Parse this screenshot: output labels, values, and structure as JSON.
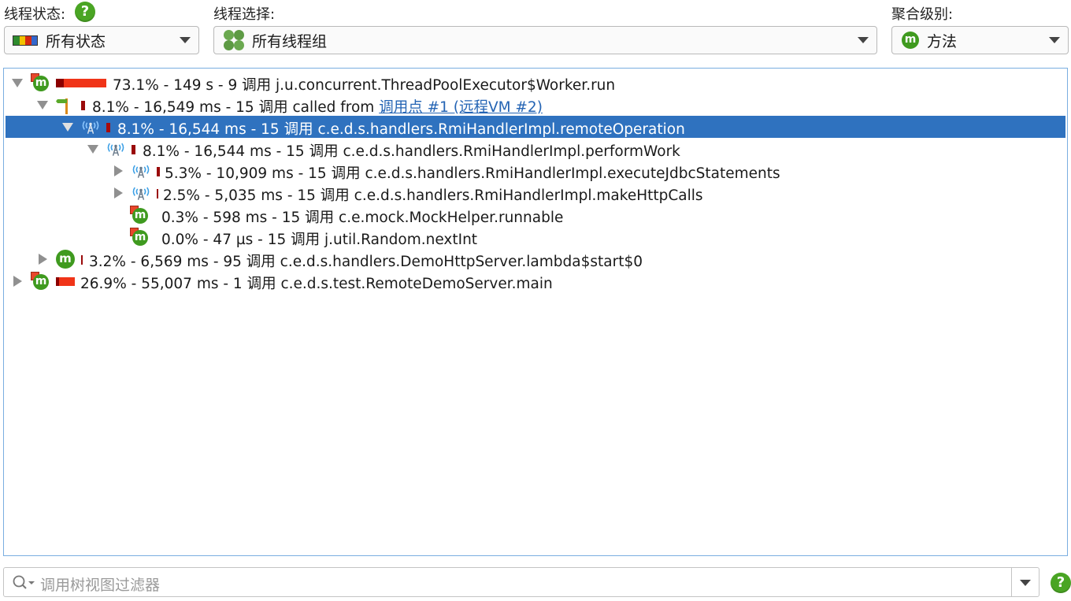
{
  "header": {
    "thread_state_label": "线程状态:",
    "thread_select_label": "线程选择:",
    "aggregation_label": "聚合级别:",
    "thread_state_value": "所有状态",
    "thread_select_value": "所有线程组",
    "aggregation_value": "方法",
    "help_glyph": "?"
  },
  "tree": {
    "rows": [
      {
        "text": "73.1% - 149 s - 9 调用 j.u.concurrent.ThreadPoolExecutor$Worker.run",
        "percent": 73.1
      },
      {
        "text": "8.1% - 16,549 ms - 15 调用 called from ",
        "link": "调用点 #1 (远程VM #2)",
        "percent": 8.1
      },
      {
        "text": "8.1% - 16,544 ms - 15 调用 c.e.d.s.handlers.RmiHandlerImpl.remoteOperation",
        "percent": 8.1,
        "selected": true
      },
      {
        "text": "8.1% - 16,544 ms - 15 调用 c.e.d.s.handlers.RmiHandlerImpl.performWork",
        "percent": 8.1
      },
      {
        "text": "5.3% - 10,909 ms - 15 调用 c.e.d.s.handlers.RmiHandlerImpl.executeJdbcStatements",
        "percent": 5.3
      },
      {
        "text": "2.5% - 5,035 ms - 15 调用 c.e.d.s.handlers.RmiHandlerImpl.makeHttpCalls",
        "percent": 2.5
      },
      {
        "text": "0.3% - 598 ms - 15 调用 c.e.mock.MockHelper.runnable",
        "percent": 0.3
      },
      {
        "text": "0.0% - 47 µs - 15 调用 j.util.Random.nextInt",
        "percent": 0.0
      },
      {
        "text": "3.2% - 6,569 ms - 95 调用 c.e.d.s.handlers.DemoHttpServer.lambda$start$0",
        "percent": 3.2
      },
      {
        "text": "26.9% - 55,007 ms - 1 调用 c.e.d.s.test.RemoteDemoServer.main",
        "percent": 26.9
      }
    ]
  },
  "filter": {
    "placeholder": "调用树视图过滤器"
  },
  "icons": {
    "method": "m",
    "colors": {
      "accent": "#3f9a1f",
      "selection": "#2f72bf",
      "bar": "#f03418",
      "bar_dark": "#8b0000",
      "link": "#2464b4"
    }
  }
}
